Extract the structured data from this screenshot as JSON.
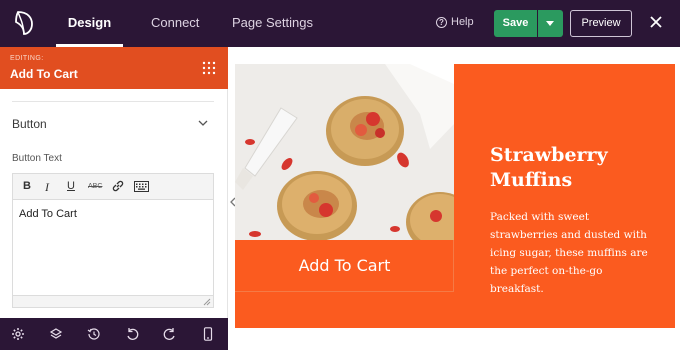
{
  "topbar": {
    "tabs": [
      {
        "label": "Design",
        "active": true
      },
      {
        "label": "Connect",
        "active": false
      },
      {
        "label": "Page Settings",
        "active": false
      }
    ],
    "help_label": "Help",
    "save_label": "Save",
    "preview_label": "Preview",
    "colors": {
      "background": "#2b1636",
      "save": "#2b9a5f"
    }
  },
  "panel": {
    "editing_label": "EDITING:",
    "editing_title": "Add To Cart",
    "section_title": "Button",
    "field_label": "Button Text",
    "editor_value": "Add To Cart",
    "toolbar_icons": [
      "bold-icon",
      "italic-icon",
      "underline-icon",
      "strikethrough-icon",
      "link-icon",
      "keyboard-icon"
    ],
    "bottom_icons": [
      "settings-icon",
      "layers-icon",
      "history-icon",
      "undo-icon",
      "redo-icon",
      "mobile-preview-icon"
    ],
    "colors": {
      "editing_bar": "#e14e20"
    }
  },
  "preview": {
    "button_text": "Add To Cart",
    "headline_line1": "Strawberry",
    "headline_line2": "Muffins",
    "description": "Packed with sweet strawberries and dusted with icing sugar, these muffins are the perfect on-the-go breakfast.",
    "colors": {
      "accent": "#fb5b1f"
    }
  }
}
